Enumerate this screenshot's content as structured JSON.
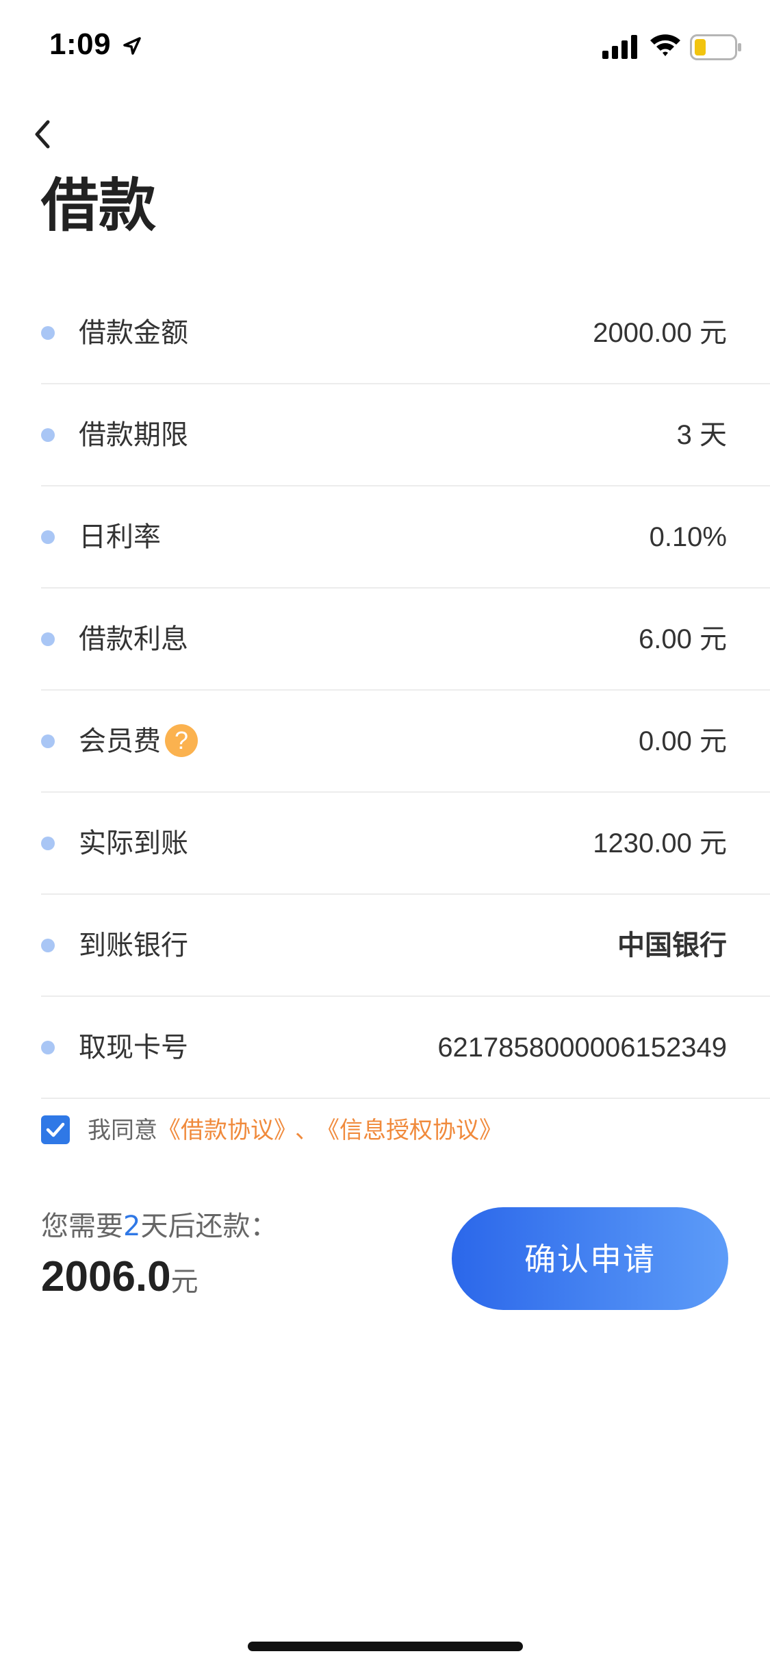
{
  "status_bar": {
    "time": "1:09"
  },
  "page": {
    "title": "借款"
  },
  "details": [
    {
      "label": "借款金额",
      "value": "2000.00  元"
    },
    {
      "label": "借款期限",
      "value": "3 天"
    },
    {
      "label": "日利率",
      "value": "0.10%"
    },
    {
      "label": "借款利息",
      "value": "6.00  元"
    },
    {
      "label": "会员费",
      "value": "0.00 元",
      "help": "?"
    },
    {
      "label": "实际到账",
      "value": "1230.00 元"
    },
    {
      "label": "到账银行",
      "value": "中国银行"
    },
    {
      "label": "取现卡号",
      "value": "6217858000006152349"
    }
  ],
  "agreement": {
    "checked": true,
    "prefix": "我同意",
    "link1": "《借款协议》",
    "separator": "、",
    "link2": "《信息授权协议》"
  },
  "repay": {
    "text_before": "您需要",
    "days": "2",
    "text_after": "天后还款：",
    "amount": "2006.0",
    "unit": "元"
  },
  "confirm_button": {
    "label": "确认申请"
  },
  "colors": {
    "accent": "#2f78e6",
    "link": "#f08a3c",
    "help": "#fbb24f",
    "dot": "#a9c6f5"
  }
}
